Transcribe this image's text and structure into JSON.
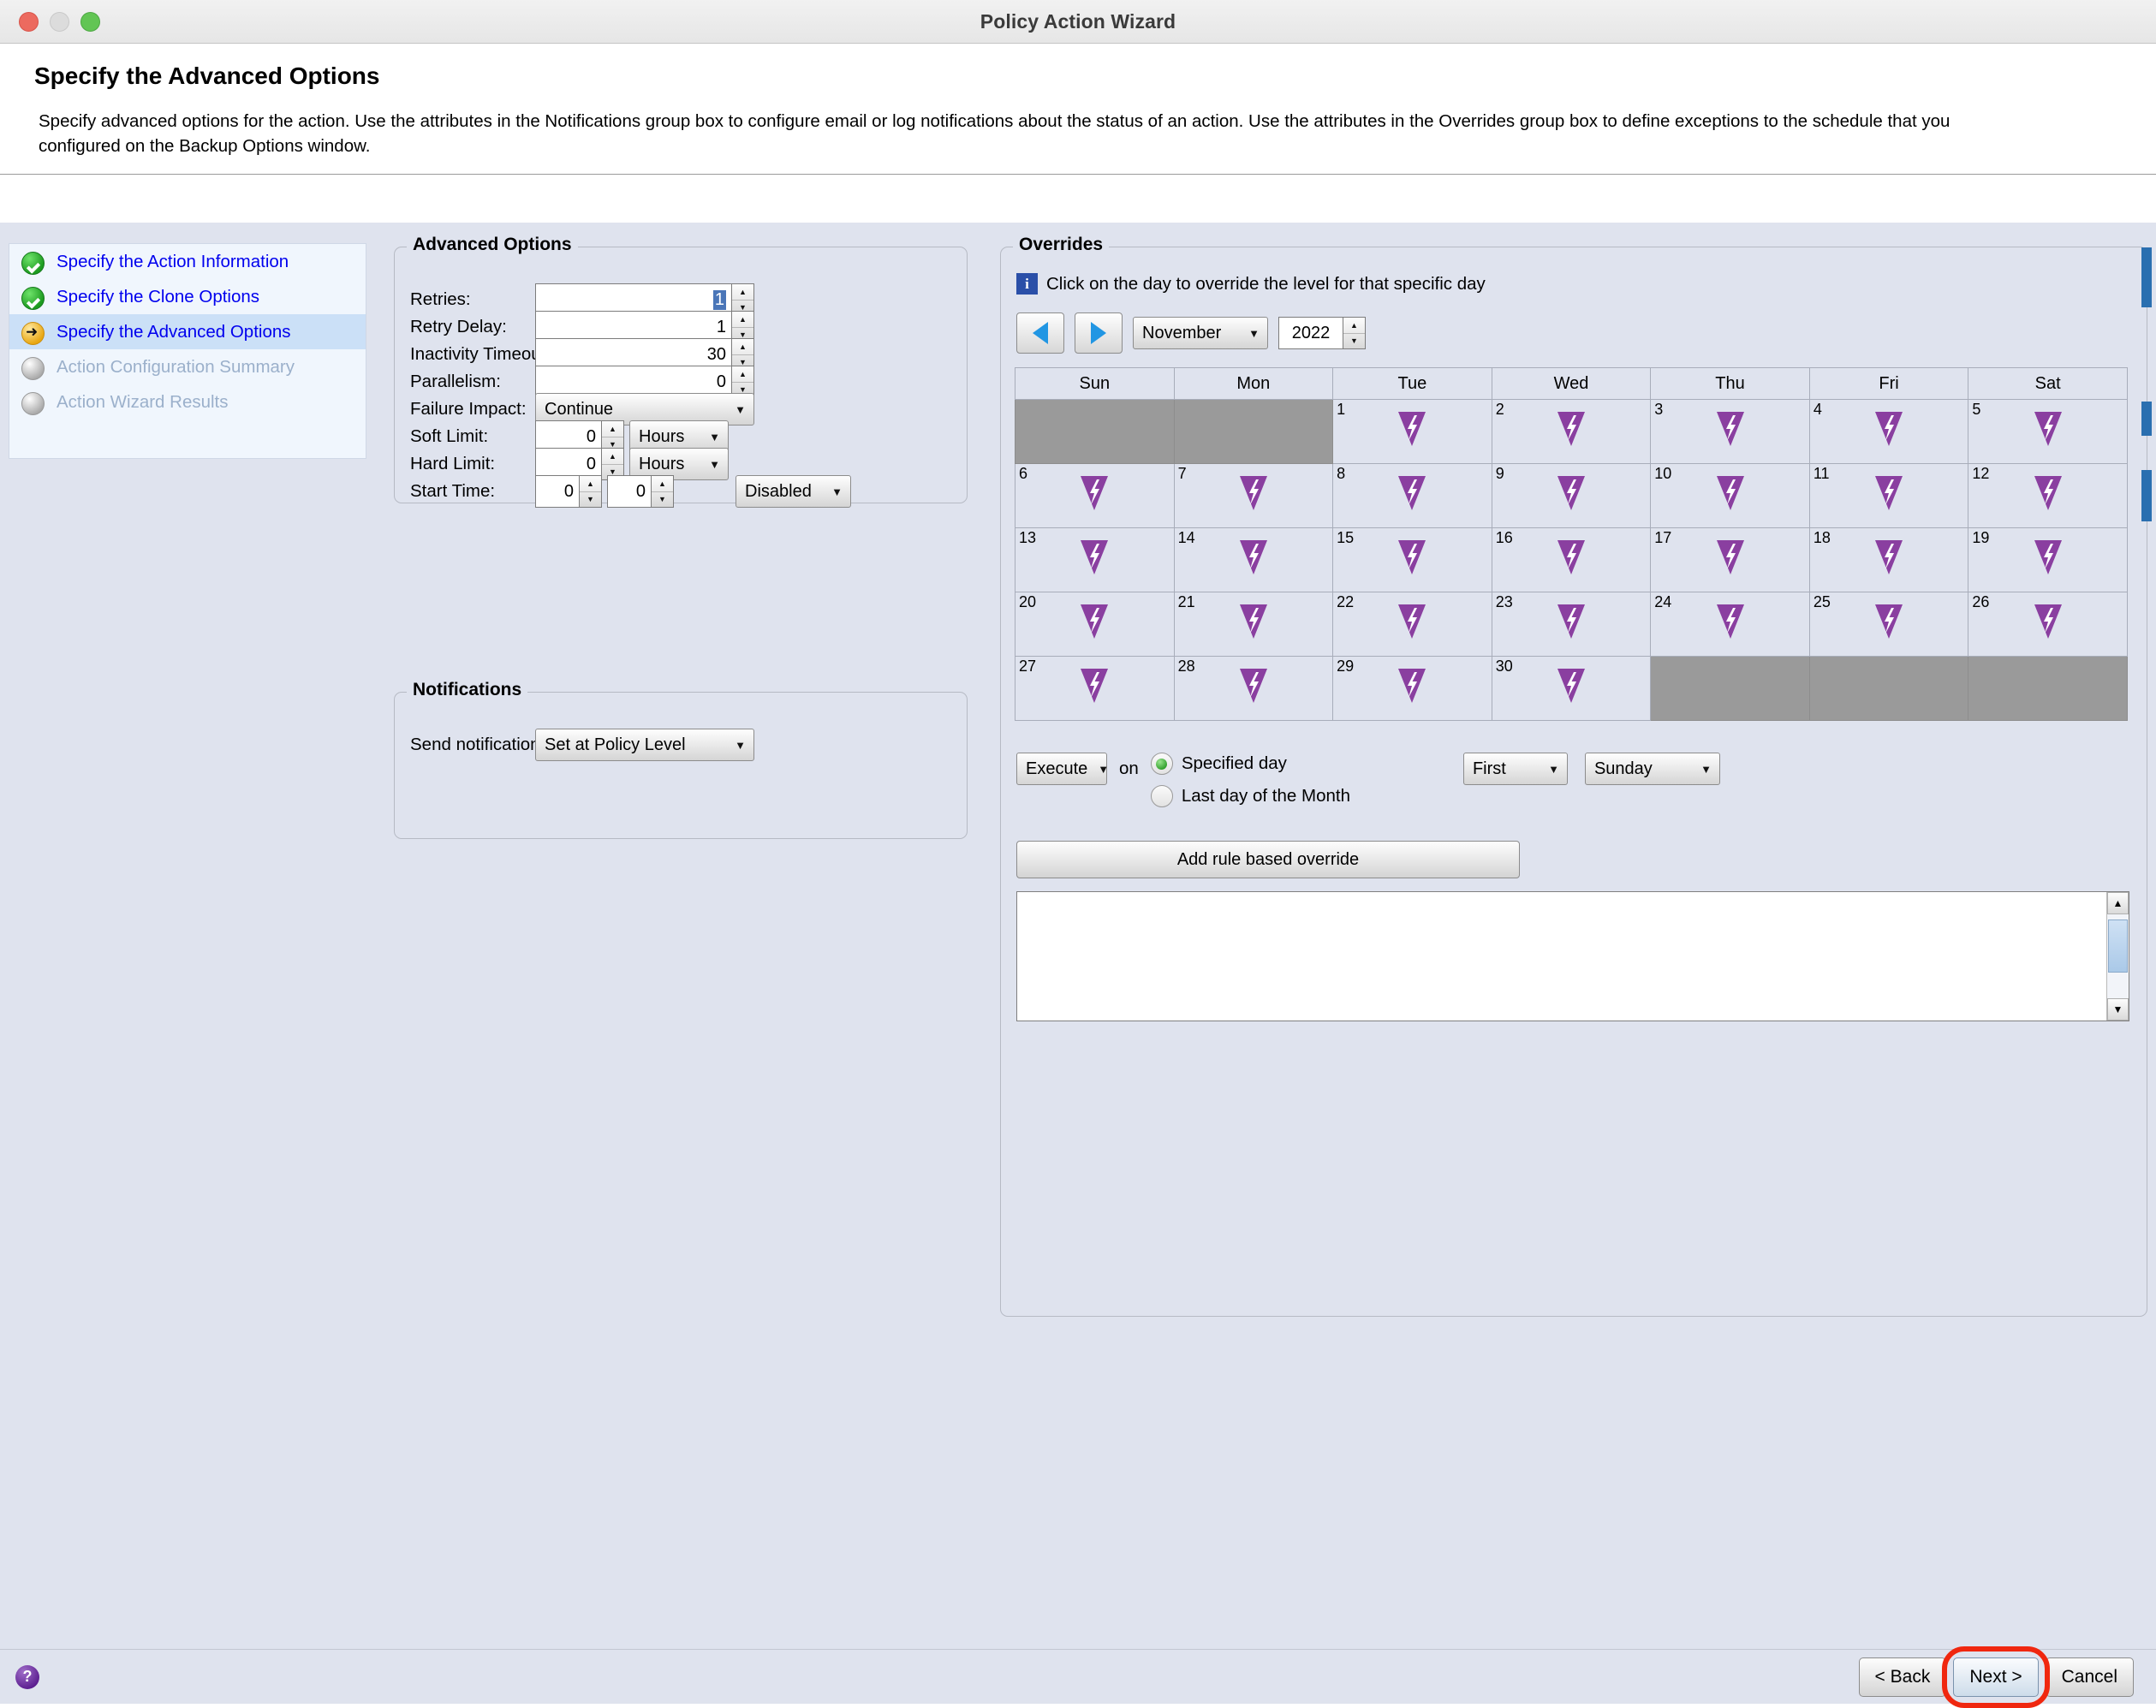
{
  "window": {
    "title": "Policy Action Wizard",
    "controls": {
      "close": "close",
      "minimize": "minimize",
      "maximize": "maximize"
    }
  },
  "header": {
    "title": "Specify the Advanced Options",
    "description": "Specify advanced options for the action. Use the attributes in the Notifications group box to configure email or log notifications about the status of an action. Use the attributes in the Overrides group box to define exceptions to the schedule that you configured on the Backup Options window."
  },
  "sidebar": {
    "items": [
      {
        "label": "Specify the Action Information",
        "state": "done"
      },
      {
        "label": "Specify the Clone Options",
        "state": "done"
      },
      {
        "label": "Specify the Advanced Options",
        "state": "active"
      },
      {
        "label": "Action Configuration Summary",
        "state": "pending"
      },
      {
        "label": "Action Wizard Results",
        "state": "pending"
      }
    ]
  },
  "advanced": {
    "legend": "Advanced Options",
    "retries": {
      "label": "Retries:",
      "value": "1"
    },
    "retry_delay": {
      "label": "Retry Delay:",
      "value": "1"
    },
    "inactivity_timeout": {
      "label": "Inactivity Timeout:",
      "value": "30"
    },
    "parallelism": {
      "label": "Parallelism:",
      "value": "0"
    },
    "failure_impact": {
      "label": "Failure Impact:",
      "value": "Continue"
    },
    "soft_limit": {
      "label": "Soft Limit:",
      "value": "0",
      "unit": "Hours"
    },
    "hard_limit": {
      "label": "Hard Limit:",
      "value": "0",
      "unit": "Hours"
    },
    "start_time": {
      "label": "Start Time:",
      "hours": "0",
      "minutes": "0",
      "state": "Disabled"
    }
  },
  "notifications": {
    "legend": "Notifications",
    "send_notification": {
      "label": "Send notification:",
      "value": "Set at Policy Level"
    }
  },
  "overrides": {
    "legend": "Overrides",
    "info_icon": "info-icon",
    "info_text": "Click on the day to override the level for that specific day",
    "prev_label": "previous month",
    "next_label": "next month",
    "month": "November",
    "year": "2022",
    "weekdays": [
      "Sun",
      "Mon",
      "Tue",
      "Wed",
      "Thu",
      "Fri",
      "Sat"
    ],
    "calendar_rows": [
      [
        null,
        null,
        1,
        2,
        3,
        4,
        5
      ],
      [
        6,
        7,
        8,
        9,
        10,
        11,
        12
      ],
      [
        13,
        14,
        15,
        16,
        17,
        18,
        19
      ],
      [
        20,
        21,
        22,
        23,
        24,
        25,
        26
      ],
      [
        27,
        28,
        29,
        30,
        null,
        null,
        null
      ]
    ],
    "day_icon": "lightning-bolt-icon",
    "day_icon_color": "#8a3fa0",
    "execute": {
      "action": "Execute",
      "on_label": "on"
    },
    "specified_day": {
      "label": "Specified day",
      "selected": true,
      "ordinal": "First",
      "weekday": "Sunday"
    },
    "last_day": {
      "label": "Last day of the Month",
      "selected": false
    },
    "add_rule_button": "Add rule based override",
    "rules_list": []
  },
  "footer": {
    "help_icon": "help-icon",
    "back": "< Back",
    "next": "Next >",
    "cancel": "Cancel",
    "highlighted": "Next >"
  }
}
